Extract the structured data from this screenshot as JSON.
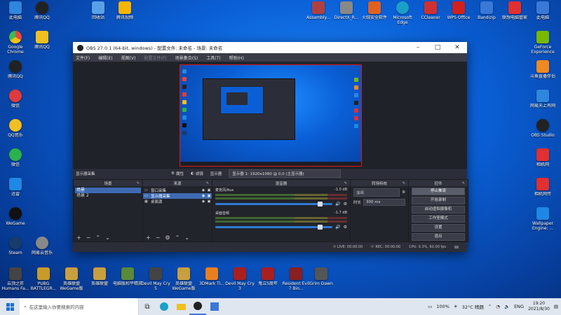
{
  "desktop": {
    "icons": [
      {
        "label": "此电脑",
        "color": "#2e86de"
      },
      {
        "label": "腾讯QQ",
        "color": "#222"
      },
      {
        "label": "Google Chrome",
        "color": "#e8453c"
      },
      {
        "label": "腾讯QQ",
        "color": "#222"
      },
      {
        "label": "微信",
        "color": "#e03b3b"
      },
      {
        "label": "QQ音乐",
        "color": "#f0c020"
      },
      {
        "label": "微信",
        "color": "#2bb24c"
      },
      {
        "label": "迅雷",
        "color": "#1e88e5"
      },
      {
        "label": "WeGame",
        "color": "#111"
      },
      {
        "label": "Steam",
        "color": "#173c6b"
      },
      {
        "label": "网易云音乐",
        "color": "#888"
      },
      {
        "label": "回收站",
        "color": "#5aa0e8"
      },
      {
        "label": "腾讯视频",
        "color": "#f7b500"
      },
      {
        "label": "QQ浏览器",
        "color": "#3ca7f0"
      },
      {
        "label": "Assembly...",
        "color": "#b04040"
      },
      {
        "label": "DirectX_R...",
        "color": "#888"
      },
      {
        "label": "火绒安全软件",
        "color": "#e06020"
      },
      {
        "label": "Microsoft Edge",
        "color": "#1aa0c8"
      },
      {
        "label": "CCleaner",
        "color": "#d03030"
      },
      {
        "label": "WPS Office",
        "color": "#d02020"
      },
      {
        "label": "Bandizip",
        "color": "#3a78d8"
      },
      {
        "label": "联想电脑管家",
        "color": "#e03030"
      },
      {
        "label": "此电脑",
        "color": "#3a78d8"
      },
      {
        "label": "GeForce Experience",
        "color": "#76b900"
      },
      {
        "label": "斗鱼直播伴侣",
        "color": "#f08a20"
      },
      {
        "label": "网易天上有网",
        "color": "#2e86de"
      },
      {
        "label": "OBS Studio",
        "color": "#222"
      },
      {
        "label": "相机网",
        "color": "#e03030"
      },
      {
        "label": "相机网传",
        "color": "#e03030"
      },
      {
        "label": "Wallpaper Engine: ...",
        "color": "#1e88e5"
      },
      {
        "label": "云顶之弈 Humans Fa...",
        "color": "#444"
      },
      {
        "label": "PUBG BATTLEGR...",
        "color": "#c89a2a"
      },
      {
        "label": "英雄联盟 WeGame版",
        "color": "#c8a040"
      },
      {
        "label": "英雄联盟",
        "color": "#c8a040"
      },
      {
        "label": "电脑版和平精英",
        "color": "#5a8a3a"
      },
      {
        "label": "Devil May Cry 5",
        "color": "#444"
      },
      {
        "label": "英雄联盟 WeGame版",
        "color": "#c8a040"
      },
      {
        "label": "3DMark Ti...",
        "color": "#e88020"
      },
      {
        "label": "Devil May Cry 3",
        "color": "#aa2020"
      },
      {
        "label": "鬼泣5周年",
        "color": "#aa2020"
      },
      {
        "label": "Resident Evil 7 Bio...",
        "color": "#8a2020"
      },
      {
        "label": "Grim Dawn",
        "color": "#555"
      }
    ]
  },
  "obs": {
    "title": "OBS 27.0.1 (64-bit, windows) - 配置文件: 未命名 - 场景: 未命名",
    "menu": [
      "文件(F)",
      "编辑(E)",
      "视图(V)",
      "配置文件(P)",
      "场景集合(S)",
      "工具(T)",
      "帮助(H)"
    ],
    "source_toolbar": {
      "selected_source": "显示器采集",
      "properties_label": "属性",
      "filters_label": "滤镜",
      "display_label": "显示器",
      "display_value": "显示器 1: 1920x1080 @ 0,0 (主显示器)"
    },
    "scenes": {
      "header": "场景",
      "items": [
        "场景",
        "场景 2"
      ]
    },
    "sources": {
      "header": "来源",
      "items": [
        {
          "name": "窗口采集",
          "icon": "window-icon"
        },
        {
          "name": "显示器采集",
          "icon": "monitor-icon"
        },
        {
          "name": "桌面源",
          "icon": "image-icon"
        }
      ]
    },
    "mixer": {
      "header": "混音器",
      "tracks": [
        {
          "name": "麦克风/Aux",
          "db": "-1.0 dB"
        },
        {
          "name": "桌面音频",
          "db": "-1.7 dB"
        }
      ]
    },
    "transitions": {
      "header": "转场特效",
      "type": "淡出",
      "duration_label": "时长",
      "duration_value": "300 ms"
    },
    "controls": {
      "header": "控件",
      "buttons": [
        "停止推流",
        "开始录制",
        "启动虚拟摄像机",
        "工作室模式",
        "设置",
        "退出"
      ]
    },
    "status": {
      "live": "LIVE: 00:00:00",
      "rec": "REC: 00:00:00",
      "cpu": "CPU: 0.3%, 60.00 fps"
    }
  },
  "taskbar": {
    "search_placeholder": "在这里输入你要搜索的内容",
    "tray": {
      "battery": "100%",
      "temp": "32°C 晴朗",
      "lang": "ENG",
      "time": "19:20",
      "date": "2021/8/30"
    }
  }
}
